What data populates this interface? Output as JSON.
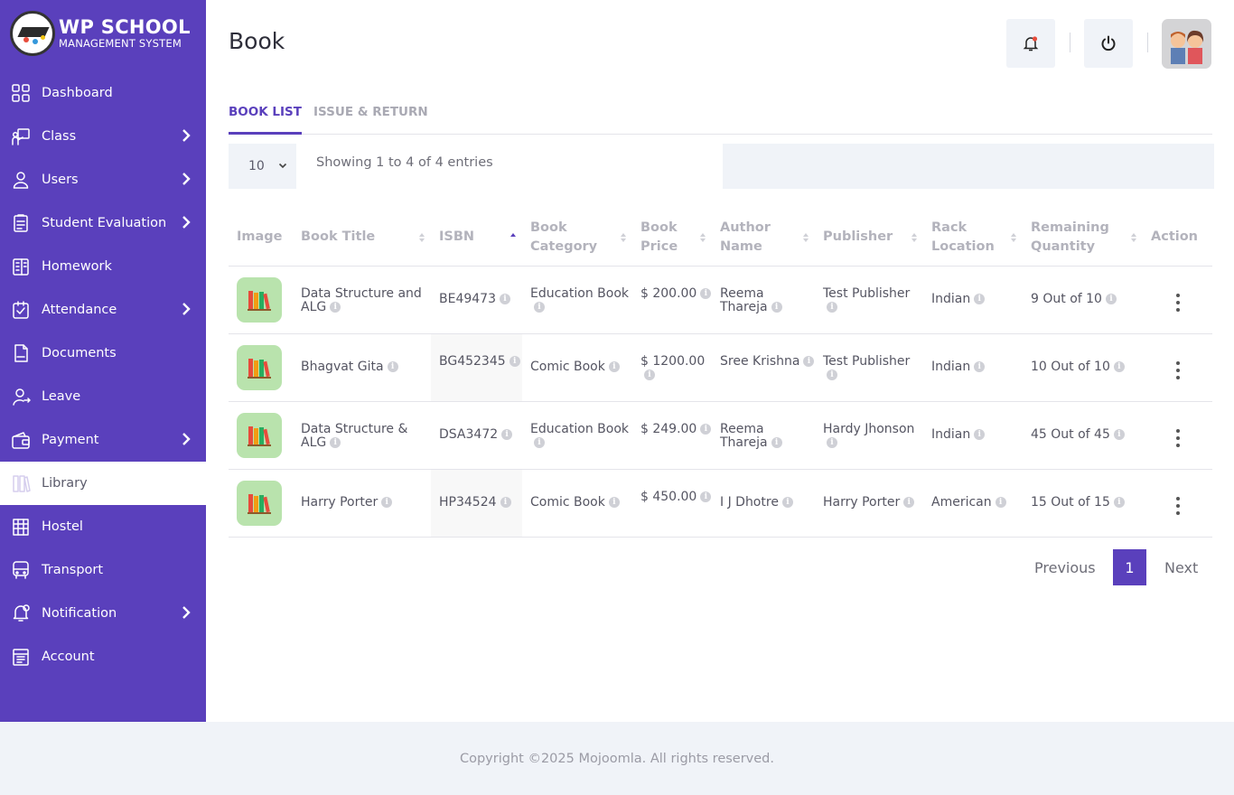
{
  "brand": {
    "title": "WP SCHOOL",
    "subtitle": "MANAGEMENT SYSTEM"
  },
  "sidebar": {
    "items": [
      {
        "label": "Dashboard",
        "icon": "dashboard-icon",
        "submenu": false,
        "active": false
      },
      {
        "label": "Class",
        "icon": "class-icon",
        "submenu": true,
        "active": false
      },
      {
        "label": "Users",
        "icon": "user-icon",
        "submenu": true,
        "active": false
      },
      {
        "label": "Student Evaluation",
        "icon": "evaluation-icon",
        "submenu": true,
        "active": false
      },
      {
        "label": "Homework",
        "icon": "homework-icon",
        "submenu": false,
        "active": false
      },
      {
        "label": "Attendance",
        "icon": "attendance-icon",
        "submenu": true,
        "active": false
      },
      {
        "label": "Documents",
        "icon": "documents-icon",
        "submenu": false,
        "active": false
      },
      {
        "label": "Leave",
        "icon": "leave-icon",
        "submenu": false,
        "active": false
      },
      {
        "label": "Payment",
        "icon": "payment-icon",
        "submenu": true,
        "active": false
      },
      {
        "label": "Library",
        "icon": "library-icon",
        "submenu": false,
        "active": true
      },
      {
        "label": "Hostel",
        "icon": "hostel-icon",
        "submenu": false,
        "active": false
      },
      {
        "label": "Transport",
        "icon": "bus-icon",
        "submenu": false,
        "active": false
      },
      {
        "label": "Notification",
        "icon": "notification-icon",
        "submenu": true,
        "active": false
      },
      {
        "label": "Account",
        "icon": "account-icon",
        "submenu": false,
        "active": false
      }
    ]
  },
  "header": {
    "title": "Book"
  },
  "tabs": [
    {
      "label": "BOOK LIST",
      "active": true
    },
    {
      "label": "ISSUE & RETURN",
      "active": false
    }
  ],
  "table_controls": {
    "page_length": "10",
    "info": "Showing 1 to 4 of 4 entries",
    "search_value": ""
  },
  "table": {
    "columns": [
      "Image",
      "Book Title",
      "ISBN",
      "Book Category",
      "Book Price",
      "Author Name",
      "Publisher",
      "Rack Location",
      "Remaining Quantity",
      "Action"
    ],
    "rows": [
      {
        "title": "Data Structure and ALG",
        "isbn": "BE49473",
        "category": "Education Book",
        "price": "$ 200.00",
        "author": "Reema Thareja",
        "publisher": "Test Publisher",
        "rack": "Indian",
        "quantity": "9 Out of 10"
      },
      {
        "title": "Bhagvat Gita",
        "isbn": "BG452345",
        "category": "Comic Book",
        "price": "$ 1200.00",
        "author": "Sree Krishna",
        "publisher": "Test Publisher",
        "rack": "Indian",
        "quantity": "10 Out of 10"
      },
      {
        "title": "Data Structure & ALG",
        "isbn": "DSA3472",
        "category": "Education Book",
        "price": "$ 249.00",
        "author": "Reema Thareja",
        "publisher": "Hardy Jhonson",
        "rack": "Indian",
        "quantity": "45 Out of 45"
      },
      {
        "title": "Harry Porter",
        "isbn": "HP34524",
        "category": "Comic Book",
        "price": "$ 450.00",
        "author": "I J Dhotre",
        "publisher": "Harry Porter",
        "rack": "American",
        "quantity": "15 Out of 15"
      }
    ]
  },
  "pagination": {
    "previous": "Previous",
    "current": "1",
    "next": "Next"
  },
  "footer": {
    "text": "Copyright ©2025 Mojoomla. All rights reserved."
  },
  "colors": {
    "primary": "#5a40bc",
    "panel": "#f0f3f8",
    "book_thumb": "#b9e3ad"
  }
}
